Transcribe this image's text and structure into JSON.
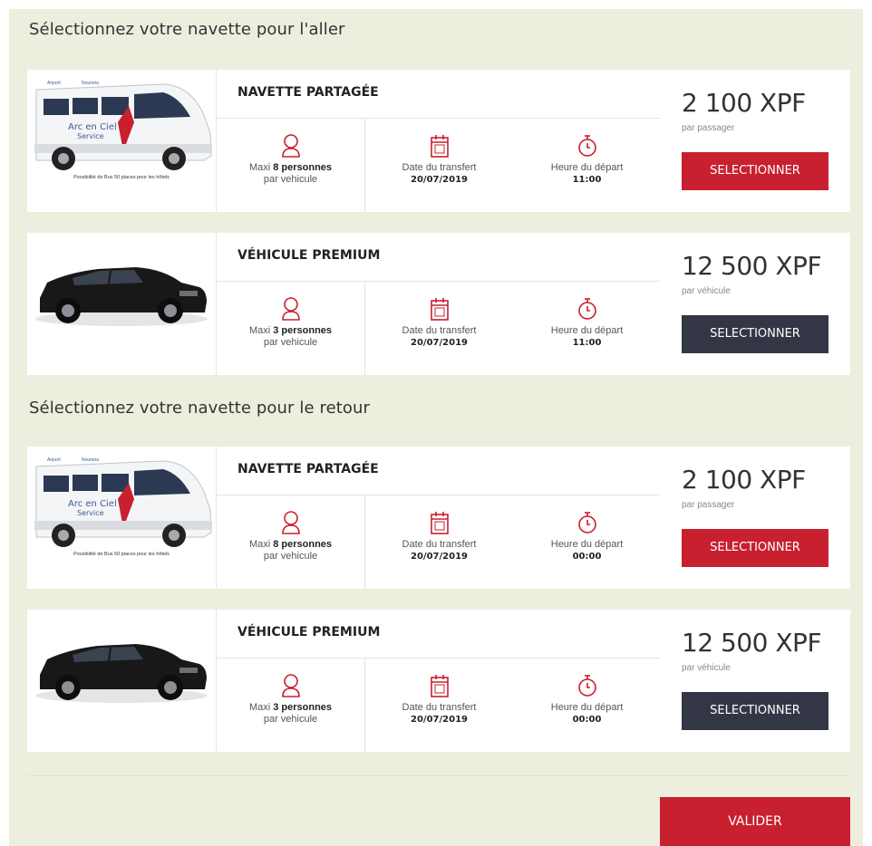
{
  "aller_title": "Sélectionnez votre navette pour l'aller",
  "retour_title": "Sélectionnez votre navette pour le retour",
  "cards": [
    {
      "name": "NAVETTE PARTAGÉE",
      "bus_caption": "Possibilité de Bus 50 places pour les hôtels",
      "bus_brand_1": "Arc en Ciel",
      "bus_brand_2": "Service",
      "maxi_prefix": "Maxi",
      "maxi_count": "8 personnes",
      "maxi_suffix": "par vehicule",
      "date_label": "Date du transfert",
      "date_value": "20/07/2019",
      "time_label": "Heure du départ",
      "time_value": "11:00",
      "price": "2 100 XPF",
      "unit": "par passager",
      "button": "SELECTIONNER",
      "button_style": "red"
    },
    {
      "name": "VÉHICULE PREMIUM",
      "maxi_prefix": "Maxi",
      "maxi_count": "3 personnes",
      "maxi_suffix": "par vehicule",
      "date_label": "Date du transfert",
      "date_value": "20/07/2019",
      "time_label": "Heure du départ",
      "time_value": "11:00",
      "price": "12 500 XPF",
      "unit": "par véhicule",
      "button": "SELECTIONNER",
      "button_style": "dark"
    },
    {
      "name": "NAVETTE PARTAGÉE",
      "bus_caption": "Possibilité de Bus 50 places pour les hôtels",
      "bus_brand_1": "Arc en Ciel",
      "bus_brand_2": "Service",
      "maxi_prefix": "Maxi",
      "maxi_count": "8 personnes",
      "maxi_suffix": "par vehicule",
      "date_label": "Date du transfert",
      "date_value": "20/07/2019",
      "time_label": "Heure du départ",
      "time_value": "00:00",
      "price": "2 100 XPF",
      "unit": "par passager",
      "button": "SELECTIONNER",
      "button_style": "red"
    },
    {
      "name": "VÉHICULE PREMIUM",
      "maxi_prefix": "Maxi",
      "maxi_count": "3 personnes",
      "maxi_suffix": "par vehicule",
      "date_label": "Date du transfert",
      "date_value": "20/07/2019",
      "time_label": "Heure du départ",
      "time_value": "00:00",
      "price": "12 500 XPF",
      "unit": "par véhicule",
      "button": "SELECTIONNER",
      "button_style": "dark"
    }
  ],
  "valider": "VALIDER",
  "colors": {
    "accent_red": "#c8202f",
    "dark_button": "#333745",
    "panel_bg": "#eeeedf",
    "icon_red": "#c8202f"
  }
}
